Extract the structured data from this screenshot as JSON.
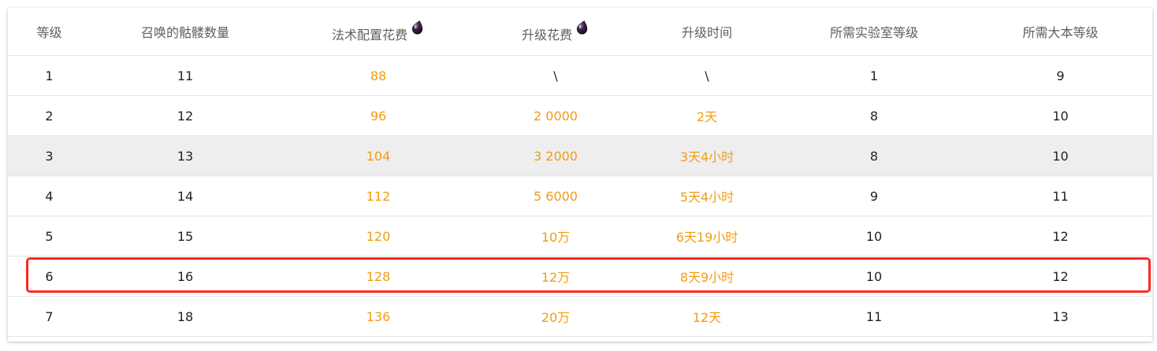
{
  "header": {
    "level": "等级",
    "skeleton_count": "召唤的骷髅数量",
    "spell_cost": "法术配置花费",
    "upgrade_cost": "升级花费",
    "upgrade_time": "升级时间",
    "lab_level": "所需实验室等级",
    "townhall_level": "所需大本等级"
  },
  "icons": {
    "cost_icon": "dark-elixir-icon"
  },
  "colors": {
    "highlight_border": "#ff2a1f",
    "orange_text": "#f39c12",
    "hover_row": "#eeeeee"
  },
  "rows": [
    {
      "level": "1",
      "skeletons": "11",
      "spell_cost": "88",
      "upgrade_cost": "\\",
      "upgrade_time": "\\",
      "lab_level": "1",
      "townhall_level": "9"
    },
    {
      "level": "2",
      "skeletons": "12",
      "spell_cost": "96",
      "upgrade_cost": "2 0000",
      "upgrade_time": "2天",
      "lab_level": "8",
      "townhall_level": "10"
    },
    {
      "level": "3",
      "skeletons": "13",
      "spell_cost": "104",
      "upgrade_cost": "3 2000",
      "upgrade_time": "3天4小时",
      "lab_level": "8",
      "townhall_level": "10"
    },
    {
      "level": "4",
      "skeletons": "14",
      "spell_cost": "112",
      "upgrade_cost": "5 6000",
      "upgrade_time": "5天4小时",
      "lab_level": "9",
      "townhall_level": "11"
    },
    {
      "level": "5",
      "skeletons": "15",
      "spell_cost": "120",
      "upgrade_cost": "10万",
      "upgrade_time": "6天19小时",
      "lab_level": "10",
      "townhall_level": "12"
    },
    {
      "level": "6",
      "skeletons": "16",
      "spell_cost": "128",
      "upgrade_cost": "12万",
      "upgrade_time": "8天9小时",
      "lab_level": "10",
      "townhall_level": "12"
    },
    {
      "level": "7",
      "skeletons": "18",
      "spell_cost": "136",
      "upgrade_cost": "20万",
      "upgrade_time": "12天",
      "lab_level": "11",
      "townhall_level": "13"
    }
  ]
}
